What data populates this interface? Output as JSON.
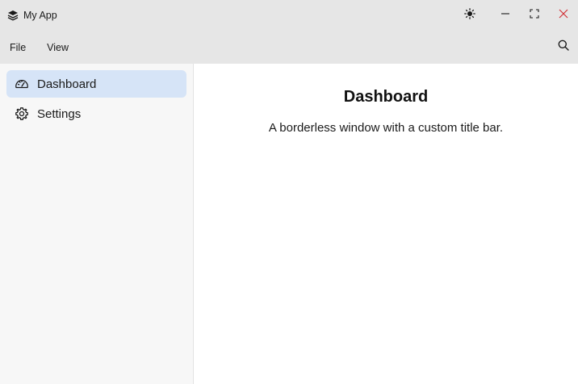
{
  "window": {
    "title": "My App",
    "icons": {
      "app": "stack-layers-icon",
      "theme": "sun-icon",
      "minimize": "minimize-icon",
      "maximize": "maximize-icon",
      "close": "close-icon"
    },
    "colors": {
      "close": "#d13438",
      "titlebar_bg": "#e6e6e6"
    }
  },
  "menubar": {
    "items": [
      {
        "label": "File"
      },
      {
        "label": "View"
      }
    ],
    "search_icon": "search-icon"
  },
  "sidebar": {
    "items": [
      {
        "label": "Dashboard",
        "icon": "gauge-icon",
        "active": true
      },
      {
        "label": "Settings",
        "icon": "gear-icon",
        "active": false
      }
    ],
    "colors": {
      "active_bg": "#d6e4f7"
    }
  },
  "main": {
    "title": "Dashboard",
    "subtitle": "A borderless window with a custom title bar."
  }
}
